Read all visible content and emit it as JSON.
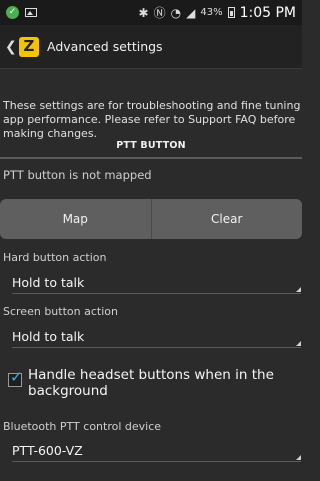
{
  "status_bar": {
    "time": "1:05 PM",
    "battery_percent": "43%",
    "icons": [
      "check-circle-icon",
      "image-icon",
      "bluetooth-icon",
      "nfc-icon",
      "wifi-icon",
      "signal-icon",
      "battery-icon"
    ]
  },
  "action_bar": {
    "title": "Advanced settings",
    "logo_letter": "Z",
    "logo_color": "#f5c400"
  },
  "intro": {
    "line1": "These settings are for troubleshooting and fine tuning",
    "line2": "app performance. Please refer to Support FAQ before",
    "line3": "making changes."
  },
  "ptt_section": {
    "header": "PTT BUTTON",
    "status": "PTT button is not mapped",
    "map_label": "Map",
    "clear_label": "Clear"
  },
  "hard_button": {
    "label": "Hard button action",
    "value": "Hold to talk"
  },
  "screen_button": {
    "label": "Screen button action",
    "value": "Hold to talk"
  },
  "headset": {
    "checked": true,
    "label_line1": "Handle headset buttons when in the",
    "label_line2": "background"
  },
  "bluetooth": {
    "label": "Bluetooth PTT control device",
    "value": "PTT-600-VZ"
  },
  "colors": {
    "accent": "#33b5e5",
    "background": "#2b2b2b",
    "button": "#5f5f5f"
  }
}
